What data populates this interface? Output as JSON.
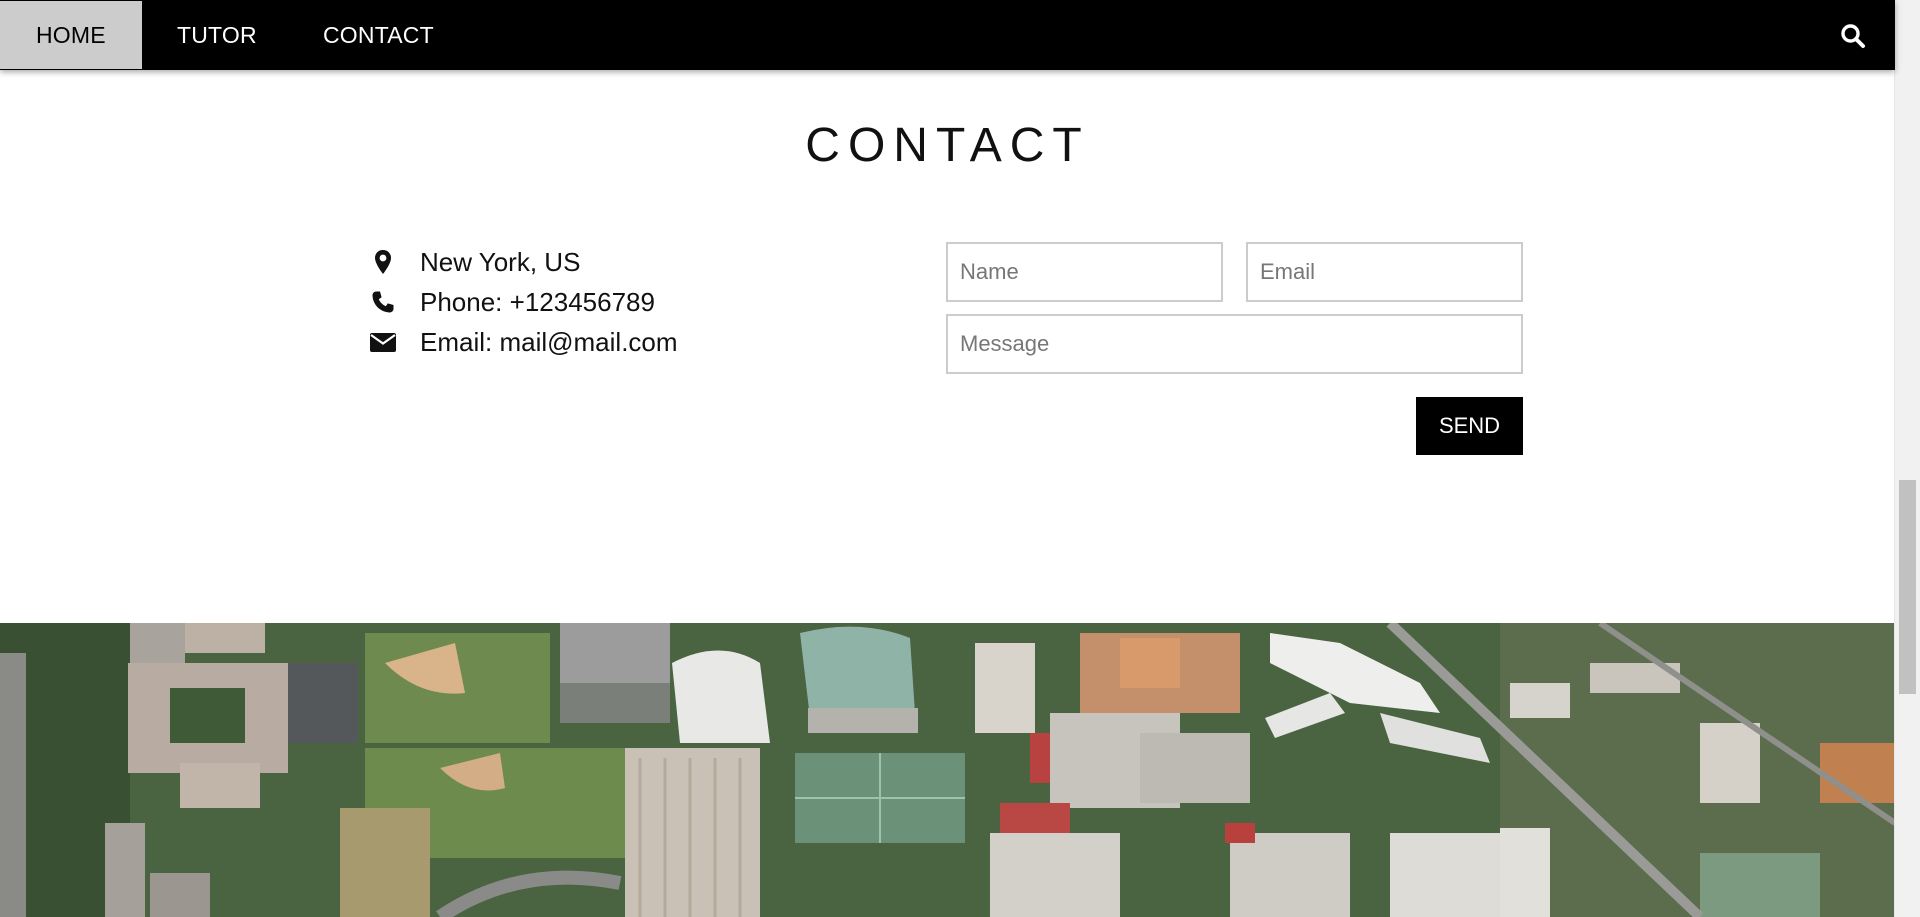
{
  "nav": {
    "items": [
      {
        "label": "HOME",
        "active": true
      },
      {
        "label": "TUTOR",
        "active": false
      },
      {
        "label": "CONTACT",
        "active": false
      }
    ],
    "search_icon": "search-icon"
  },
  "contact": {
    "title": "CONTACT",
    "location": "New York, US",
    "phone": "Phone: +123456789",
    "email": "Email: mail@mail.com",
    "icons": [
      "map-marker-icon",
      "phone-icon",
      "envelope-icon"
    ]
  },
  "form": {
    "name_placeholder": "Name",
    "email_placeholder": "Email",
    "message_placeholder": "Message",
    "send_label": "SEND"
  },
  "colors": {
    "nav_bg": "#000000",
    "nav_active_bg": "#cccccc",
    "button_bg": "#000000",
    "field_border": "#cccccc"
  },
  "image": {
    "subject": "aerial-city-campus-photo"
  }
}
